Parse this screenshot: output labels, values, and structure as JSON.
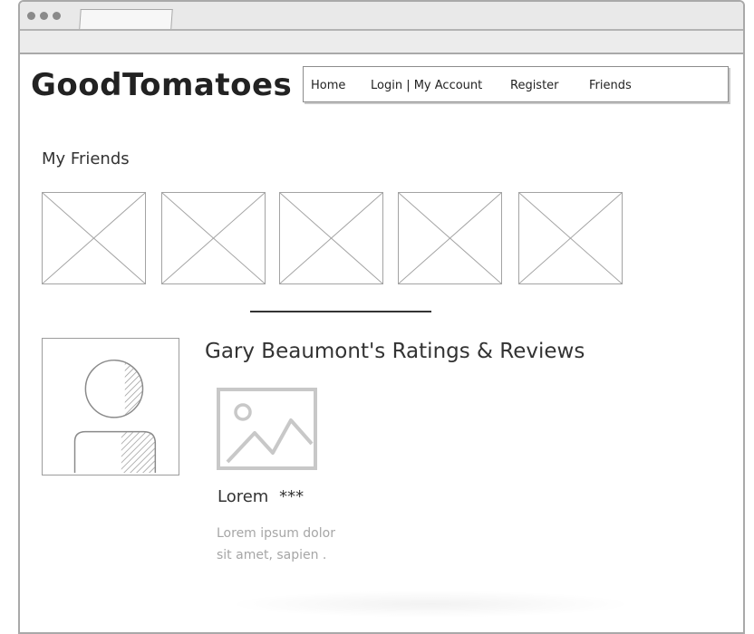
{
  "site": {
    "logo": "GoodTomatoes"
  },
  "nav": {
    "items": [
      {
        "label": "Home"
      },
      {
        "label": "Login | My Account"
      },
      {
        "label": "Register"
      },
      {
        "label": "Friends"
      }
    ]
  },
  "friends": {
    "title": "My Friends",
    "count": 5
  },
  "profile": {
    "reviews_title": "Gary Beaumont's Ratings & Reviews"
  },
  "review": {
    "movie": "Lorem",
    "rating": "***",
    "text": "Lorem ipsum dolor sit amet, sapien ."
  },
  "colors": {
    "border": "#a9a9a9",
    "text": "#333333",
    "muted_text": "#a6a6a6",
    "placeholder_icon": "#c8c8c8"
  }
}
